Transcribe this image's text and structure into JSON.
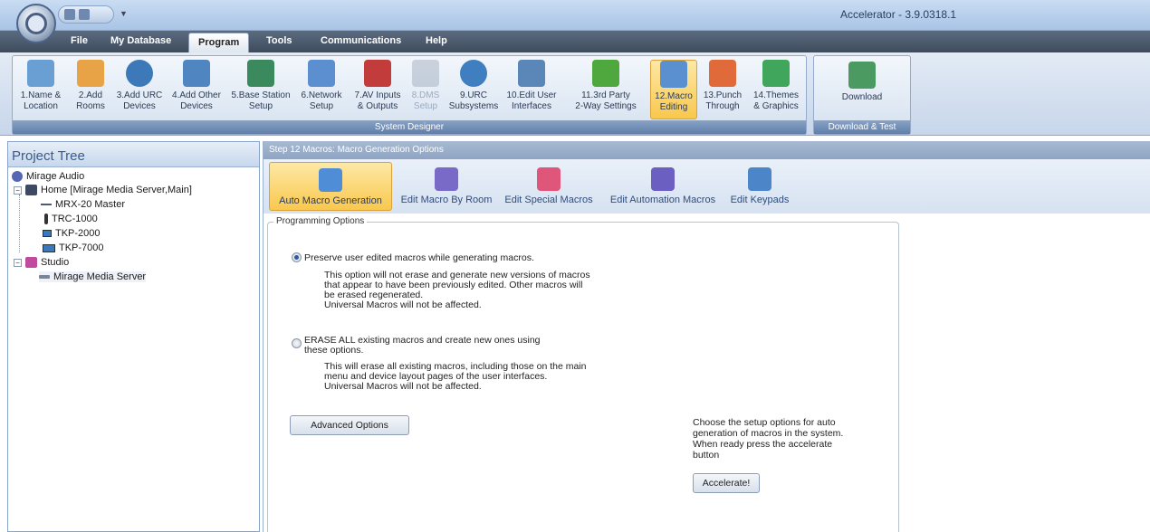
{
  "window": {
    "title": "Accelerator - 3.9.0318.1"
  },
  "menu_tabs": [
    "File",
    "My Database",
    "Program",
    "Tools",
    "Communications",
    "Help"
  ],
  "ribbon": {
    "groups": {
      "system_designer": "System Designer",
      "download_test": "Download & Test"
    },
    "buttons": [
      {
        "line1": "1.Name &",
        "line2": "Location",
        "icon": "name-location-icon",
        "color": "#6a9fd4"
      },
      {
        "line1": "2.Add",
        "line2": "Rooms",
        "icon": "house-icon",
        "color": "#e8a347"
      },
      {
        "line1": "3.Add URC",
        "line2": "Devices",
        "icon": "urc-device-icon",
        "color": "#3d79b8"
      },
      {
        "line1": "4.Add Other",
        "line2": "Devices",
        "icon": "other-devices-icon",
        "color": "#4f86c2"
      },
      {
        "line1": "5.Base Station",
        "line2": "Setup",
        "icon": "base-station-icon",
        "color": "#3a8a5e"
      },
      {
        "line1": "6.Network",
        "line2": "Setup",
        "icon": "network-icon",
        "color": "#5b8fd0"
      },
      {
        "line1": "7.AV Inputs",
        "line2": "& Outputs",
        "icon": "av-cables-icon",
        "color": "#c23c3c"
      },
      {
        "line1": "8.DMS",
        "line2": "Setup",
        "icon": "dms-icon",
        "color": "#9aa7b8"
      },
      {
        "line1": "9.URC",
        "line2": "Subsystems",
        "icon": "subsystems-icon",
        "color": "#3f7fc0"
      },
      {
        "line1": "10.Edit User",
        "line2": "Interfaces",
        "icon": "user-interface-icon",
        "color": "#5b87b8"
      },
      {
        "line1": "11.3rd Party",
        "line2": "2-Way Settings",
        "icon": "two-way-arrows-icon",
        "color": "#4fa83d"
      },
      {
        "line1": "12.Macro",
        "line2": "Editing",
        "icon": "macro-editing-icon",
        "color": "#5a8fd0"
      },
      {
        "line1": "13.Punch",
        "line2": "Through",
        "icon": "punch-through-icon",
        "color": "#e06a3a"
      },
      {
        "line1": "14.Themes",
        "line2": "& Graphics",
        "icon": "themes-icon",
        "color": "#3fa65b"
      }
    ],
    "download_label": "Download"
  },
  "project_tree": {
    "title": "Project Tree",
    "items": [
      {
        "label": "Mirage Audio"
      },
      {
        "label": "Home [Mirage Media Server,Main]"
      },
      {
        "label": "MRX-20 Master"
      },
      {
        "label": "TRC-1000"
      },
      {
        "label": "TKP-2000"
      },
      {
        "label": "TKP-7000"
      },
      {
        "label": "Studio"
      },
      {
        "label": "Mirage Media Server"
      }
    ]
  },
  "main": {
    "step_title": "Step 12 Macros: Macro Generation Options",
    "subtabs": [
      "Auto Macro Generation",
      "Edit Macro By Room",
      "Edit Special Macros",
      "Edit Automation Macros",
      "Edit Keypads"
    ],
    "options_legend": "Programming Options",
    "option1": {
      "label": "Preserve user edited macros while generating macros.",
      "selected": true,
      "desc": [
        "This option will not erase and generate new versions of macros",
        "that appear to have been previously edited. Other macros will",
        "be erased regenerated.",
        "Universal Macros will not be affected."
      ]
    },
    "option2": {
      "label_line1": "ERASE ALL existing macros and create new ones using",
      "label_line2": "these options.",
      "selected": false,
      "desc": [
        "This will erase all existing macros, including those on the main",
        "menu and device layout pages of the user interfaces.",
        "Universal Macros will not be affected."
      ]
    },
    "advanced_button": "Advanced Options",
    "help_text": [
      "Choose the setup options for auto",
      "generation of macros in the system.",
      "When ready press the accelerate",
      "button"
    ],
    "accelerate_button": "Accelerate!"
  }
}
